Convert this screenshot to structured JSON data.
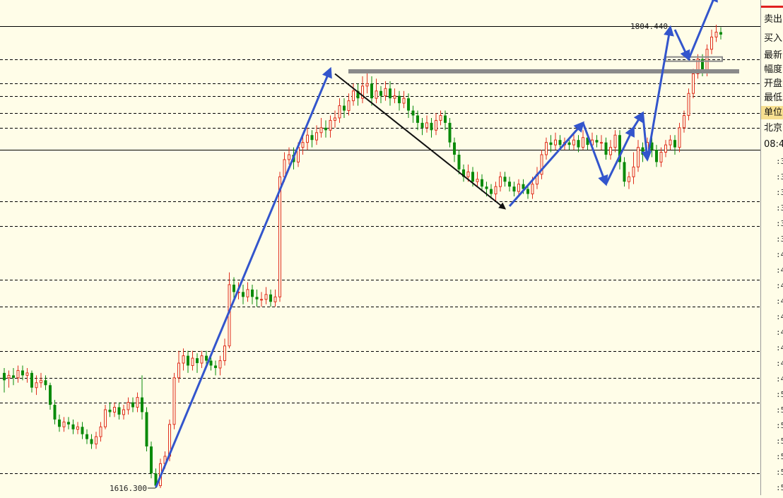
{
  "chart_data": {
    "type": "candlestick",
    "annotations": {
      "high_label": "1804.440",
      "low_label": "1616.300"
    },
    "candles": [
      [
        1663,
        1660,
        1665,
        1655
      ],
      [
        1661,
        1662,
        1664,
        1657
      ],
      [
        1662,
        1661,
        1665,
        1658
      ],
      [
        1661,
        1664,
        1666,
        1659
      ],
      [
        1664,
        1662,
        1666,
        1660
      ],
      [
        1662,
        1663,
        1665,
        1659
      ],
      [
        1663,
        1657,
        1664,
        1655
      ],
      [
        1657,
        1659,
        1662,
        1654
      ],
      [
        1659,
        1660,
        1663,
        1657
      ],
      [
        1660,
        1658,
        1662,
        1656
      ],
      [
        1658,
        1650,
        1659,
        1648
      ],
      [
        1650,
        1644,
        1652,
        1642
      ],
      [
        1644,
        1641,
        1646,
        1639
      ],
      [
        1641,
        1643,
        1645,
        1639
      ],
      [
        1643,
        1642,
        1645,
        1640
      ],
      [
        1642,
        1640,
        1644,
        1638
      ],
      [
        1640,
        1641,
        1643,
        1638
      ],
      [
        1641,
        1638,
        1643,
        1636
      ],
      [
        1638,
        1636,
        1640,
        1634
      ],
      [
        1636,
        1634,
        1638,
        1632
      ],
      [
        1634,
        1637,
        1639,
        1632
      ],
      [
        1637,
        1641,
        1643,
        1635
      ],
      [
        1641,
        1648,
        1650,
        1640
      ],
      [
        1648,
        1647,
        1651,
        1645
      ],
      [
        1647,
        1649,
        1651,
        1645
      ],
      [
        1649,
        1646,
        1651,
        1644
      ],
      [
        1646,
        1648,
        1650,
        1644
      ],
      [
        1648,
        1651,
        1653,
        1646
      ],
      [
        1651,
        1649,
        1653,
        1647
      ],
      [
        1649,
        1653,
        1655,
        1647
      ],
      [
        1653,
        1647,
        1662,
        1644
      ],
      [
        1647,
        1633,
        1649,
        1631
      ],
      [
        1633,
        1622,
        1635,
        1620
      ],
      [
        1622,
        1617,
        1624,
        1616
      ],
      [
        1617,
        1626,
        1628,
        1616
      ],
      [
        1626,
        1629,
        1631,
        1624
      ],
      [
        1629,
        1642,
        1644,
        1627
      ],
      [
        1642,
        1661,
        1663,
        1640
      ],
      [
        1661,
        1667,
        1672,
        1659
      ],
      [
        1667,
        1670,
        1673,
        1664
      ],
      [
        1670,
        1666,
        1672,
        1663
      ],
      [
        1666,
        1669,
        1672,
        1664
      ],
      [
        1669,
        1667,
        1671,
        1663
      ],
      [
        1667,
        1670,
        1672,
        1665
      ],
      [
        1670,
        1668,
        1672,
        1666
      ],
      [
        1668,
        1666,
        1670,
        1664
      ],
      [
        1666,
        1665,
        1668,
        1662
      ],
      [
        1665,
        1668,
        1670,
        1662
      ],
      [
        1668,
        1674,
        1677,
        1666
      ],
      [
        1674,
        1699,
        1704,
        1673
      ],
      [
        1699,
        1696,
        1702,
        1693
      ],
      [
        1696,
        1696,
        1700,
        1693
      ],
      [
        1696,
        1694,
        1699,
        1691
      ],
      [
        1694,
        1697,
        1700,
        1692
      ],
      [
        1697,
        1694,
        1699,
        1691
      ],
      [
        1694,
        1693,
        1697,
        1690
      ],
      [
        1693,
        1693,
        1696,
        1690
      ],
      [
        1693,
        1695,
        1698,
        1691
      ],
      [
        1695,
        1692,
        1697,
        1690
      ],
      [
        1692,
        1694,
        1697,
        1690
      ],
      [
        1694,
        1743,
        1745,
        1692
      ],
      [
        1743,
        1750,
        1753,
        1741
      ],
      [
        1750,
        1752,
        1755,
        1748
      ],
      [
        1752,
        1749,
        1755,
        1746
      ],
      [
        1749,
        1755,
        1757,
        1747
      ],
      [
        1755,
        1757,
        1760,
        1752
      ],
      [
        1757,
        1760,
        1763,
        1754
      ],
      [
        1760,
        1758,
        1762,
        1755
      ],
      [
        1758,
        1761,
        1764,
        1756
      ],
      [
        1761,
        1763,
        1767,
        1759
      ],
      [
        1763,
        1762,
        1766,
        1759
      ],
      [
        1762,
        1766,
        1768,
        1759
      ],
      [
        1766,
        1767,
        1770,
        1763
      ],
      [
        1767,
        1772,
        1775,
        1765
      ],
      [
        1772,
        1770,
        1775,
        1767
      ],
      [
        1770,
        1774,
        1777,
        1768
      ],
      [
        1774,
        1778,
        1781,
        1772
      ],
      [
        1778,
        1775,
        1781,
        1772
      ],
      [
        1775,
        1780,
        1784,
        1773
      ],
      [
        1780,
        1781,
        1786,
        1777
      ],
      [
        1781,
        1775,
        1784,
        1772
      ],
      [
        1775,
        1778,
        1783,
        1773
      ],
      [
        1778,
        1776,
        1780,
        1773
      ],
      [
        1776,
        1779,
        1782,
        1774
      ],
      [
        1779,
        1775,
        1782,
        1772
      ],
      [
        1775,
        1776,
        1779,
        1773
      ],
      [
        1776,
        1773,
        1778,
        1770
      ],
      [
        1773,
        1775,
        1778,
        1771
      ],
      [
        1775,
        1770,
        1777,
        1767
      ],
      [
        1770,
        1768,
        1772,
        1765
      ],
      [
        1768,
        1765,
        1770,
        1762
      ],
      [
        1765,
        1763,
        1767,
        1760
      ],
      [
        1763,
        1765,
        1768,
        1761
      ],
      [
        1765,
        1762,
        1767,
        1759
      ],
      [
        1762,
        1766,
        1769,
        1760
      ],
      [
        1766,
        1768,
        1770,
        1764
      ],
      [
        1768,
        1765,
        1770,
        1762
      ],
      [
        1765,
        1757,
        1767,
        1755
      ],
      [
        1757,
        1752,
        1759,
        1749
      ],
      [
        1752,
        1746,
        1754,
        1744
      ],
      [
        1746,
        1743,
        1748,
        1741
      ],
      [
        1743,
        1745,
        1748,
        1741
      ],
      [
        1745,
        1741,
        1747,
        1739
      ],
      [
        1741,
        1742,
        1745,
        1739
      ],
      [
        1742,
        1739,
        1744,
        1737
      ],
      [
        1739,
        1738,
        1741,
        1735
      ],
      [
        1738,
        1736,
        1740,
        1734
      ],
      [
        1736,
        1739,
        1741,
        1733
      ],
      [
        1739,
        1743,
        1745,
        1737
      ],
      [
        1743,
        1741,
        1745,
        1739
      ],
      [
        1741,
        1739,
        1743,
        1737
      ],
      [
        1739,
        1737,
        1741,
        1735
      ],
      [
        1737,
        1740,
        1742,
        1735
      ],
      [
        1740,
        1738,
        1742,
        1736
      ],
      [
        1738,
        1736,
        1740,
        1734
      ],
      [
        1736,
        1740,
        1743,
        1734
      ],
      [
        1740,
        1744,
        1747,
        1738
      ],
      [
        1744,
        1752,
        1754,
        1742
      ],
      [
        1752,
        1757,
        1759,
        1750
      ],
      [
        1757,
        1756,
        1760,
        1753
      ],
      [
        1756,
        1758,
        1761,
        1754
      ],
      [
        1758,
        1756,
        1760,
        1754
      ],
      [
        1756,
        1757,
        1759,
        1754
      ],
      [
        1757,
        1756,
        1759,
        1754
      ],
      [
        1756,
        1758,
        1761,
        1754
      ],
      [
        1758,
        1755,
        1760,
        1753
      ],
      [
        1755,
        1759,
        1762,
        1754
      ],
      [
        1759,
        1756,
        1761,
        1754
      ],
      [
        1756,
        1758,
        1761,
        1754
      ],
      [
        1758,
        1757,
        1760,
        1755
      ],
      [
        1757,
        1757,
        1760,
        1754
      ],
      [
        1757,
        1752,
        1759,
        1750
      ],
      [
        1752,
        1755,
        1758,
        1750
      ],
      [
        1755,
        1760,
        1762,
        1753
      ],
      [
        1760,
        1749,
        1762,
        1746
      ],
      [
        1749,
        1741,
        1751,
        1739
      ],
      [
        1741,
        1743,
        1745,
        1738
      ],
      [
        1743,
        1747,
        1753,
        1740
      ],
      [
        1747,
        1755,
        1758,
        1745
      ],
      [
        1755,
        1752,
        1757,
        1749
      ],
      [
        1752,
        1757,
        1759,
        1750
      ],
      [
        1757,
        1754,
        1759,
        1751
      ],
      [
        1754,
        1749,
        1756,
        1747
      ],
      [
        1749,
        1753,
        1755,
        1747
      ],
      [
        1753,
        1756,
        1758,
        1751
      ],
      [
        1756,
        1758,
        1760,
        1754
      ],
      [
        1758,
        1755,
        1760,
        1752
      ],
      [
        1755,
        1763,
        1765,
        1753
      ],
      [
        1763,
        1768,
        1770,
        1761
      ],
      [
        1768,
        1777,
        1779,
        1766
      ],
      [
        1777,
        1785,
        1787,
        1775
      ],
      [
        1785,
        1791,
        1793,
        1783
      ],
      [
        1791,
        1786,
        1793,
        1784
      ],
      [
        1786,
        1795,
        1797,
        1784
      ],
      [
        1795,
        1800,
        1803,
        1793
      ],
      [
        1800,
        1802,
        1805,
        1798
      ],
      [
        1802,
        1801,
        1804,
        1799
      ]
    ],
    "trend_arrows": [
      {
        "color": "#3355cc",
        "from": [
          33,
          1616.3
        ],
        "to": [
          71,
          1787
        ]
      },
      {
        "color": "#111111",
        "from": [
          72,
          1785
        ],
        "to": [
          109,
          1730
        ]
      },
      {
        "color": "#3355cc",
        "from": [
          110,
          1731
        ],
        "to": [
          126,
          1765
        ]
      },
      {
        "color": "#3355cc",
        "from": [
          126,
          1765
        ],
        "to": [
          131,
          1740
        ]
      },
      {
        "color": "#3355cc",
        "from": [
          131,
          1740
        ],
        "to": [
          137,
          1763
        ]
      },
      {
        "color": "#3355cc",
        "from": [
          137,
          1763
        ],
        "to": [
          139,
          1769
        ]
      },
      {
        "color": "#3355cc",
        "from": [
          139,
          1769
        ],
        "to": [
          140,
          1750
        ]
      },
      {
        "color": "#3355cc",
        "from": [
          140,
          1750
        ],
        "to": [
          145,
          1804
        ]
      },
      {
        "color": "#3355cc",
        "from": [
          146,
          1803
        ],
        "to": [
          149,
          1791
        ]
      },
      {
        "color": "#3355cc",
        "from": [
          149,
          1791
        ],
        "to": [
          155,
          1818
        ]
      }
    ],
    "levels": {
      "resistance_band": 1786,
      "small_box": 1791,
      "solid_lines": [
        1804.44,
        1754
      ],
      "dashed_lines": [
        1791,
        1781,
        1776,
        1769,
        1763,
        1733,
        1723,
        1701,
        1690,
        1672,
        1661,
        1651,
        1622
      ]
    },
    "colors": {
      "up": "#e0301e",
      "down": "#0a8a0a",
      "background": "#fffde8"
    }
  },
  "sidebar": {
    "items": [
      {
        "label": "卖出",
        "highlight": false
      },
      {
        "label": "买入",
        "highlight": false
      },
      {
        "label": "最新",
        "highlight": false
      },
      {
        "label": "幅度",
        "highlight": false
      },
      {
        "label": "开盘",
        "highlight": false
      },
      {
        "label": "最低",
        "highlight": false
      },
      {
        "label": "单位",
        "highlight": true
      },
      {
        "label": "北京",
        "highlight": false
      },
      {
        "label": "08:4",
        "highlight": false
      }
    ],
    "tape": [
      ":3",
      ":3",
      ":3",
      ":3",
      ":3",
      ":3",
      ":4",
      ":4",
      ":4",
      ":4",
      ":4",
      ":4",
      ":4",
      ":4",
      ":4",
      ":5",
      ":5",
      ":5",
      ":5",
      ":5",
      ":5",
      ":5"
    ]
  }
}
